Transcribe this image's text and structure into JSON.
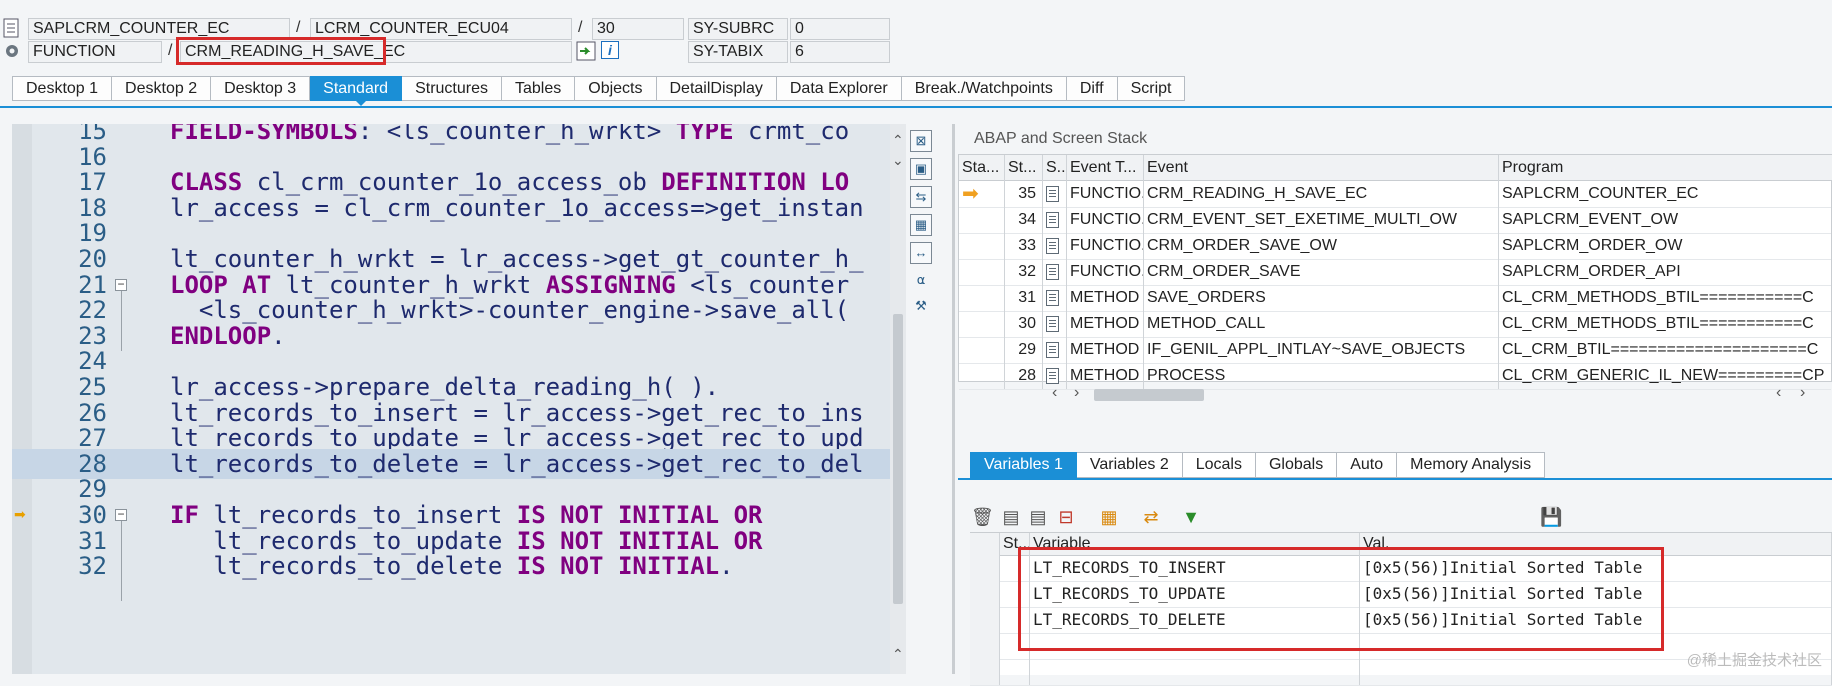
{
  "header": {
    "row1": {
      "program": "SAPLCRM_COUNTER_EC",
      "include": "LCRM_COUNTER_ECU04",
      "line": "30",
      "sysvar": "SY-SUBRC",
      "sysval": "0"
    },
    "row2": {
      "type": "FUNCTION",
      "name": "CRM_READING_H_SAVE_EC",
      "sysvar": "SY-TABIX",
      "sysval": "6"
    },
    "sep": "/"
  },
  "tabs": [
    "Desktop 1",
    "Desktop 2",
    "Desktop 3",
    "Standard",
    "Structures",
    "Tables",
    "Objects",
    "DetailDisplay",
    "Data Explorer",
    "Break./Watchpoints",
    "Diff",
    "Script"
  ],
  "active_tab": "Standard",
  "code": [
    {
      "n": "15",
      "t": "FIELD-SYMBOLS: <ls_counter_h_wrkt> TYPE crmt_co"
    },
    {
      "n": "16",
      "t": ""
    },
    {
      "n": "17",
      "t": "CLASS cl_crm_counter_1o_access_ob DEFINITION LO"
    },
    {
      "n": "18",
      "t": "lr_access = cl_crm_counter_1o_access=>get_instan"
    },
    {
      "n": "19",
      "t": ""
    },
    {
      "n": "20",
      "t": "lt_counter_h_wrkt = lr_access->get_gt_counter_h_"
    },
    {
      "n": "21",
      "t": "LOOP AT lt_counter_h_wrkt ASSIGNING <ls_counter"
    },
    {
      "n": "22",
      "t": "  <ls_counter_h_wrkt>-counter_engine->save_all("
    },
    {
      "n": "23",
      "t": "ENDLOOP."
    },
    {
      "n": "24",
      "t": ""
    },
    {
      "n": "25",
      "t": "lr_access->prepare_delta_reading_h( )."
    },
    {
      "n": "26",
      "t": "lt_records_to_insert = lr_access->get_rec_to_ins"
    },
    {
      "n": "27",
      "t": "lt_records_to_update = lr_access->get_rec_to_upd"
    },
    {
      "n": "28",
      "t": "lt_records_to_delete = lr_access->get_rec_to_del"
    },
    {
      "n": "29",
      "t": ""
    },
    {
      "n": "30",
      "t": "IF lt_records_to_insert IS NOT INITIAL OR"
    },
    {
      "n": "31",
      "t": "   lt_records_to_update IS NOT INITIAL OR"
    },
    {
      "n": "32",
      "t": "   lt_records_to_delete IS NOT INITIAL."
    }
  ],
  "stack": {
    "title": "ABAP and Screen Stack",
    "columns": [
      "Sta...",
      "St...",
      "S..",
      "Event T...",
      "Event",
      "Program"
    ],
    "rows": [
      {
        "current": true,
        "no": "35",
        "etype": "FUNCTIO...",
        "event": "CRM_READING_H_SAVE_EC",
        "program": "SAPLCRM_COUNTER_EC"
      },
      {
        "current": false,
        "no": "34",
        "etype": "FUNCTIO...",
        "event": "CRM_EVENT_SET_EXETIME_MULTI_OW",
        "program": "SAPLCRM_EVENT_OW"
      },
      {
        "current": false,
        "no": "33",
        "etype": "FUNCTIO...",
        "event": "CRM_ORDER_SAVE_OW",
        "program": "SAPLCRM_ORDER_OW"
      },
      {
        "current": false,
        "no": "32",
        "etype": "FUNCTIO...",
        "event": "CRM_ORDER_SAVE",
        "program": "SAPLCRM_ORDER_API"
      },
      {
        "current": false,
        "no": "31",
        "etype": "METHOD",
        "event": "SAVE_ORDERS",
        "program": "CL_CRM_METHODS_BTIL===========C"
      },
      {
        "current": false,
        "no": "30",
        "etype": "METHOD",
        "event": "METHOD_CALL",
        "program": "CL_CRM_METHODS_BTIL===========C"
      },
      {
        "current": false,
        "no": "29",
        "etype": "METHOD",
        "event": "IF_GENIL_APPL_INTLAY~SAVE_OBJECTS",
        "program": "CL_CRM_BTIL=====================C"
      },
      {
        "current": false,
        "no": "28",
        "etype": "METHOD",
        "event": "PROCESS",
        "program": "CL_CRM_GENERIC_IL_NEW=========CP"
      }
    ]
  },
  "vartabs": [
    "Variables 1",
    "Variables 2",
    "Locals",
    "Globals",
    "Auto",
    "Memory Analysis"
  ],
  "active_vartab": "Variables 1",
  "variables": {
    "columns": [
      "St...",
      "Variable",
      "Val."
    ],
    "rows": [
      {
        "name": "LT_RECORDS_TO_INSERT",
        "value": "[0x5(56)]Initial Sorted Table"
      },
      {
        "name": "LT_RECORDS_TO_UPDATE",
        "value": "[0x5(56)]Initial Sorted Table"
      },
      {
        "name": "LT_RECORDS_TO_DELETE",
        "value": "[0x5(56)]Initial Sorted Table"
      }
    ]
  },
  "watermark": "@稀土掘金技术社区",
  "colors": {
    "accent": "#1b8fd6",
    "highlight_box": "#d62a2a",
    "keyword": "#800080"
  }
}
